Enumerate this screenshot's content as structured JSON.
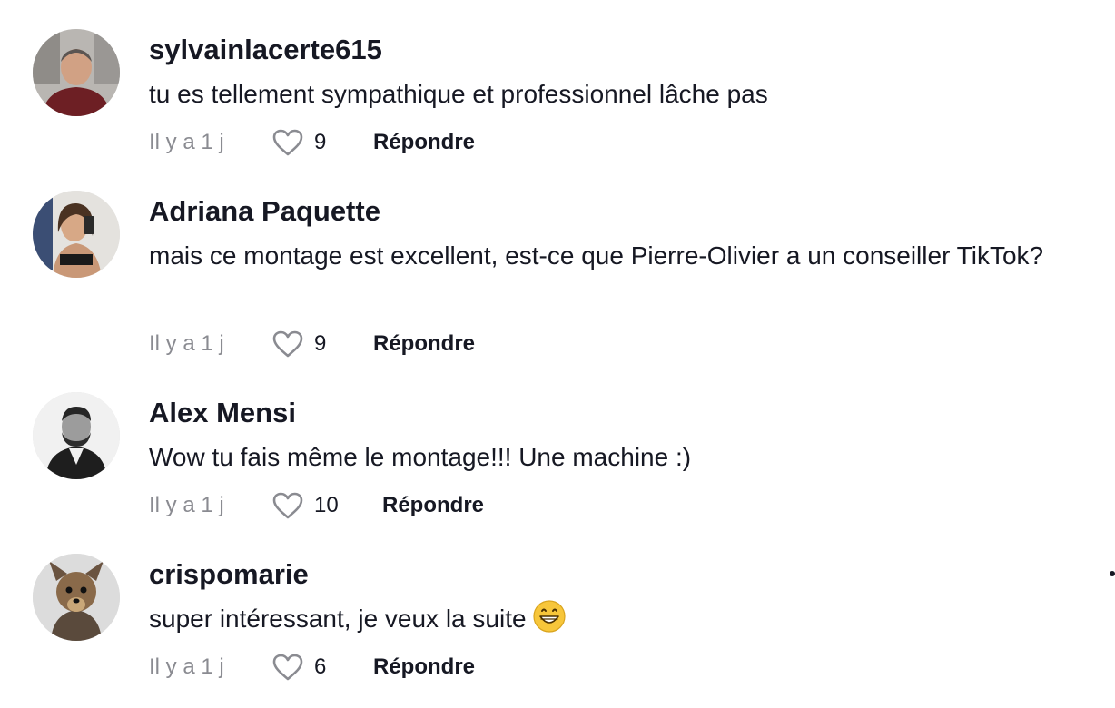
{
  "comments": [
    {
      "username": "sylvainlacerte615",
      "text": "tu es tellement sympathique et professionnel lâche pas",
      "time": "Il y a 1 j",
      "likes": "9",
      "reply_label": "Répondre",
      "avatar_icon": "profile-photo-man-smiling"
    },
    {
      "username": "Adriana Paquette",
      "text": "mais ce montage est excellent, est-ce que Pierre-Olivier a un conseiller TikTok?",
      "time": "Il y a 1 j",
      "likes": "9",
      "reply_label": "Répondre",
      "avatar_icon": "profile-photo-woman-selfie"
    },
    {
      "username": "Alex Mensi",
      "text": "Wow tu fais même le montage!!! Une machine :)",
      "time": "Il y a 1 j",
      "likes": "10",
      "reply_label": "Répondre",
      "avatar_icon": "profile-photo-man-bw"
    },
    {
      "username": "crispomarie",
      "text": "super intéressant, je veux la suite",
      "emoji": "😁",
      "time": "Il y a 1 j",
      "likes": "6",
      "reply_label": "Répondre",
      "avatar_icon": "profile-photo-dog"
    }
  ],
  "icons": {
    "like": "heart-outline-icon",
    "emoji": "grinning-face-icon"
  },
  "colors": {
    "text": "#161823",
    "meta": "#8a8b91",
    "emoji_yellow": "#f7c63a"
  }
}
